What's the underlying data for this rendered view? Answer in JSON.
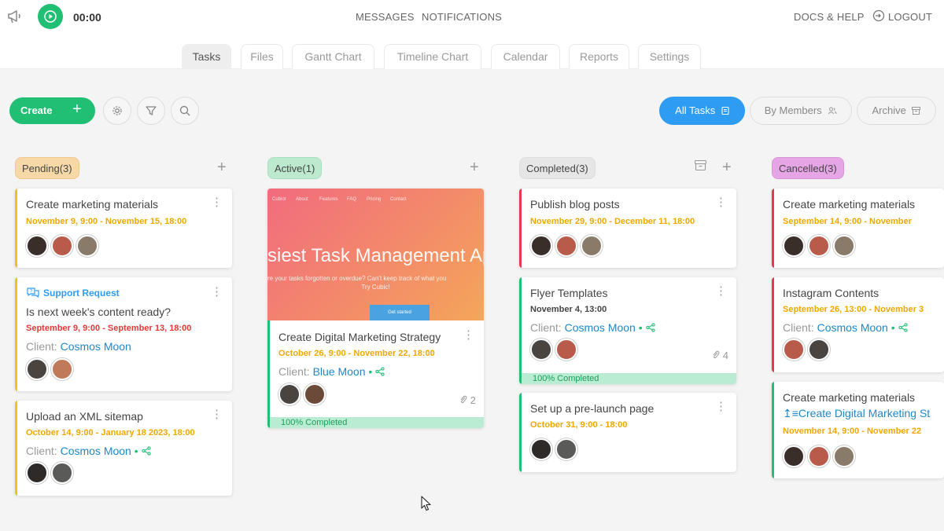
{
  "topbar": {
    "timer": "00:00",
    "messages": "MESSAGES",
    "notifications": "NOTIFICATIONS",
    "docs": "DOCS & HELP",
    "logout": "LOGOUT"
  },
  "tabs": [
    "Tasks",
    "Files",
    "Gantt Chart",
    "Timeline Chart",
    "Calendar",
    "Reports",
    "Settings"
  ],
  "toolbar": {
    "create": "Create",
    "views": [
      "All Tasks",
      "By Members",
      "Archive"
    ]
  },
  "colors": {
    "accent_green": "#21bf73",
    "accent_blue": "#2d9cf2",
    "pending": "#f7d9a8",
    "active": "#bdeacf",
    "completed": "#e6e6e6",
    "cancelled": "#e6a6e6"
  },
  "columns": {
    "pending": {
      "label": "Pending(3)",
      "cards": [
        {
          "title": "Create marketing materials",
          "date": "November 9, 9:00 - November 15, 18:00"
        },
        {
          "tag": "Support Request",
          "title": "Is next week's content ready?",
          "date": "September 9, 9:00 - September 13, 18:00",
          "client_label": "Client:",
          "client": "Cosmos Moon"
        },
        {
          "title": "Upload an XML sitemap",
          "date": "October 14, 9:00 - January 18 2023, 18:00",
          "client_label": "Client:",
          "client": "Cosmos Moon"
        }
      ]
    },
    "active": {
      "label": "Active(1)",
      "cards": [
        {
          "cover": {
            "nav": [
              "Cubiot",
              "About",
              "Features",
              "FAQ",
              "Pricing",
              "Contact"
            ],
            "headline": "siest Task Management Ap",
            "sub_line1": "re your tasks forgotten or overdue? Can't keep track of what you",
            "sub_line2": "Try Cubic!",
            "button": "Get started"
          },
          "title": "Create Digital Marketing Strategy",
          "date": "October 26, 9:00 - November 22, 18:00",
          "client_label": "Client:",
          "client": "Blue Moon",
          "attachments": "2",
          "progress": "100% Completed"
        }
      ]
    },
    "completed": {
      "label": "Completed(3)",
      "cards": [
        {
          "title": "Publish blog posts",
          "date": "November 29, 9:00 - December 11, 18:00"
        },
        {
          "title": "Flyer Templates",
          "date": "November 4, 13:00",
          "client_label": "Client:",
          "client": "Cosmos Moon",
          "attachments": "4",
          "progress": "100% Completed"
        },
        {
          "title": "Set up a pre-launch page",
          "date": "October 31, 9:00 - 18:00"
        }
      ]
    },
    "cancelled": {
      "label": "Cancelled(3)",
      "cards": [
        {
          "title": "Create marketing materials",
          "date": "September 14, 9:00 - November"
        },
        {
          "title": "Instagram Contents",
          "date": "September 26, 13:00 - November 3",
          "client_label": "Client:",
          "client": "Cosmos Moon"
        },
        {
          "title": "Create marketing materials",
          "subtask": "Create Digital Marketing St",
          "date": "November 14, 9:00 - November 22"
        }
      ]
    }
  }
}
